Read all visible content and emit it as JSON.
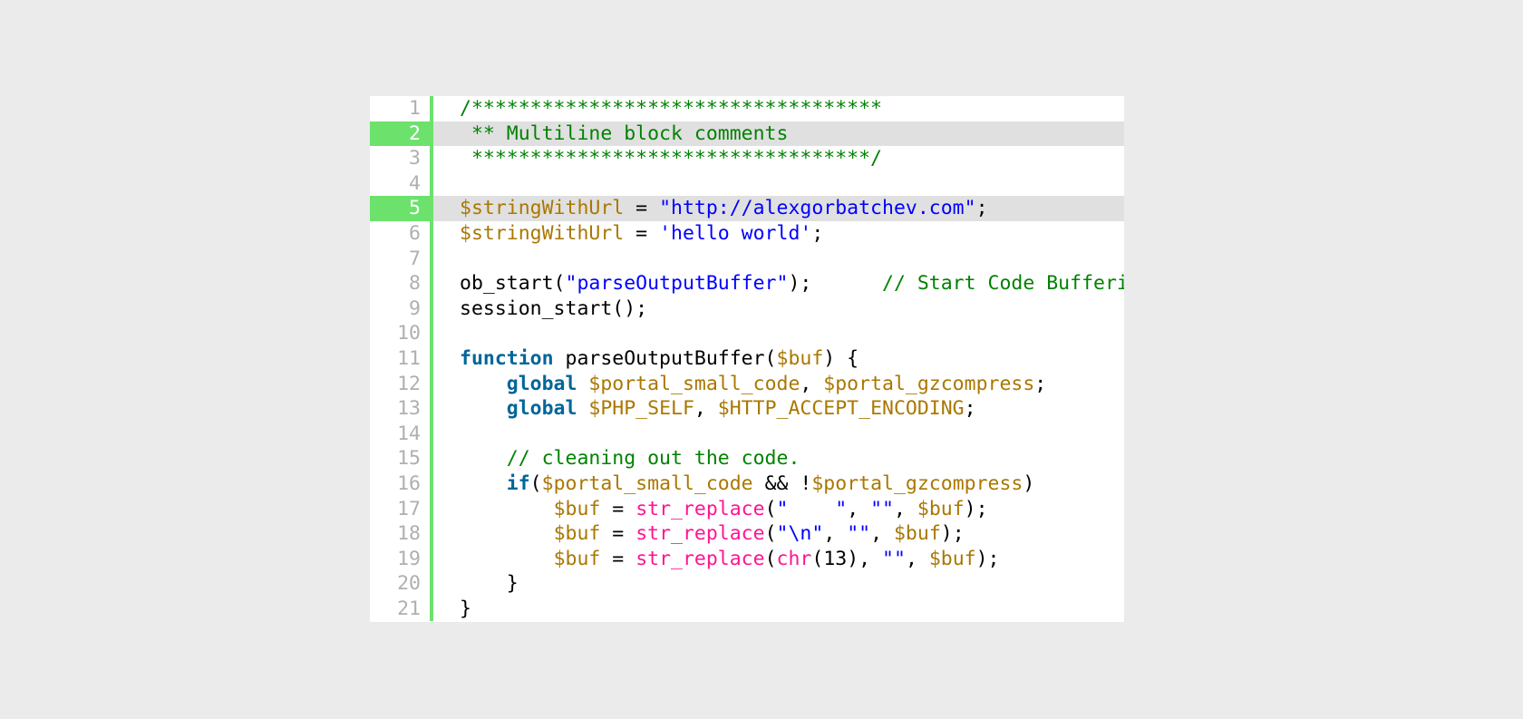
{
  "code_viewer": {
    "highlighted_lines": [
      2,
      5
    ],
    "colors": {
      "background": "#ebebeb",
      "gutter_accent": "#6ce26c",
      "highlight_row": "#e0e0e0",
      "line_number": "#afafaf",
      "comment": "#008200",
      "variable": "#aa7700",
      "string": "#0000ff",
      "keyword": "#006699",
      "function": "#ff1493"
    },
    "lines": [
      {
        "number": "1",
        "tokens": [
          {
            "t": "comment",
            "v": "/***********************************"
          }
        ]
      },
      {
        "number": "2",
        "tokens": [
          {
            "t": "comment",
            "v": " ** Multiline block comments"
          }
        ]
      },
      {
        "number": "3",
        "tokens": [
          {
            "t": "comment",
            "v": " **********************************/"
          }
        ]
      },
      {
        "number": "4",
        "tokens": []
      },
      {
        "number": "5",
        "tokens": [
          {
            "t": "var",
            "v": "$stringWithUrl"
          },
          {
            "t": "plain",
            "v": " = "
          },
          {
            "t": "str",
            "v": "\"http://alexgorbatchev.com\""
          },
          {
            "t": "plain",
            "v": ";"
          }
        ]
      },
      {
        "number": "6",
        "tokens": [
          {
            "t": "var",
            "v": "$stringWithUrl"
          },
          {
            "t": "plain",
            "v": " = "
          },
          {
            "t": "str",
            "v": "'hello world'"
          },
          {
            "t": "plain",
            "v": ";"
          }
        ]
      },
      {
        "number": "7",
        "tokens": []
      },
      {
        "number": "8",
        "tokens": [
          {
            "t": "plain",
            "v": "ob_start("
          },
          {
            "t": "str",
            "v": "\"parseOutputBuffer\""
          },
          {
            "t": "plain",
            "v": ");      "
          },
          {
            "t": "comment",
            "v": "// Start Code Buffering"
          }
        ]
      },
      {
        "number": "9",
        "tokens": [
          {
            "t": "plain",
            "v": "session_start();"
          }
        ]
      },
      {
        "number": "10",
        "tokens": []
      },
      {
        "number": "11",
        "tokens": [
          {
            "t": "kw",
            "v": "function"
          },
          {
            "t": "plain",
            "v": " parseOutputBuffer("
          },
          {
            "t": "var",
            "v": "$buf"
          },
          {
            "t": "plain",
            "v": ") {"
          }
        ]
      },
      {
        "number": "12",
        "tokens": [
          {
            "t": "plain",
            "v": "    "
          },
          {
            "t": "kw",
            "v": "global"
          },
          {
            "t": "plain",
            "v": " "
          },
          {
            "t": "var",
            "v": "$portal_small_code"
          },
          {
            "t": "plain",
            "v": ", "
          },
          {
            "t": "var",
            "v": "$portal_gzcompress"
          },
          {
            "t": "plain",
            "v": ";"
          }
        ]
      },
      {
        "number": "13",
        "tokens": [
          {
            "t": "plain",
            "v": "    "
          },
          {
            "t": "kw",
            "v": "global"
          },
          {
            "t": "plain",
            "v": " "
          },
          {
            "t": "var",
            "v": "$PHP_SELF"
          },
          {
            "t": "plain",
            "v": ", "
          },
          {
            "t": "var",
            "v": "$HTTP_ACCEPT_ENCODING"
          },
          {
            "t": "plain",
            "v": ";"
          }
        ]
      },
      {
        "number": "14",
        "tokens": []
      },
      {
        "number": "15",
        "tokens": [
          {
            "t": "plain",
            "v": "    "
          },
          {
            "t": "comment",
            "v": "// cleaning out the code."
          }
        ]
      },
      {
        "number": "16",
        "tokens": [
          {
            "t": "plain",
            "v": "    "
          },
          {
            "t": "kw",
            "v": "if"
          },
          {
            "t": "plain",
            "v": "("
          },
          {
            "t": "var",
            "v": "$portal_small_code"
          },
          {
            "t": "plain",
            "v": " && !"
          },
          {
            "t": "var",
            "v": "$portal_gzcompress"
          },
          {
            "t": "plain",
            "v": ")"
          }
        ]
      },
      {
        "number": "17",
        "tokens": [
          {
            "t": "plain",
            "v": "        "
          },
          {
            "t": "var",
            "v": "$buf"
          },
          {
            "t": "plain",
            "v": " = "
          },
          {
            "t": "fn",
            "v": "str_replace"
          },
          {
            "t": "plain",
            "v": "("
          },
          {
            "t": "str",
            "v": "\"    \""
          },
          {
            "t": "plain",
            "v": ", "
          },
          {
            "t": "str",
            "v": "\"\""
          },
          {
            "t": "plain",
            "v": ", "
          },
          {
            "t": "var",
            "v": "$buf"
          },
          {
            "t": "plain",
            "v": ");"
          }
        ]
      },
      {
        "number": "18",
        "tokens": [
          {
            "t": "plain",
            "v": "        "
          },
          {
            "t": "var",
            "v": "$buf"
          },
          {
            "t": "plain",
            "v": " = "
          },
          {
            "t": "fn",
            "v": "str_replace"
          },
          {
            "t": "plain",
            "v": "("
          },
          {
            "t": "str",
            "v": "\"\\n\""
          },
          {
            "t": "plain",
            "v": ", "
          },
          {
            "t": "str",
            "v": "\"\""
          },
          {
            "t": "plain",
            "v": ", "
          },
          {
            "t": "var",
            "v": "$buf"
          },
          {
            "t": "plain",
            "v": ");"
          }
        ]
      },
      {
        "number": "19",
        "tokens": [
          {
            "t": "plain",
            "v": "        "
          },
          {
            "t": "var",
            "v": "$buf"
          },
          {
            "t": "plain",
            "v": " = "
          },
          {
            "t": "fn",
            "v": "str_replace"
          },
          {
            "t": "plain",
            "v": "("
          },
          {
            "t": "fn",
            "v": "chr"
          },
          {
            "t": "plain",
            "v": "(13), "
          },
          {
            "t": "str",
            "v": "\"\""
          },
          {
            "t": "plain",
            "v": ", "
          },
          {
            "t": "var",
            "v": "$buf"
          },
          {
            "t": "plain",
            "v": ");"
          }
        ]
      },
      {
        "number": "20",
        "tokens": [
          {
            "t": "plain",
            "v": "    }"
          }
        ]
      },
      {
        "number": "21",
        "tokens": [
          {
            "t": "plain",
            "v": "}"
          }
        ]
      }
    ]
  }
}
